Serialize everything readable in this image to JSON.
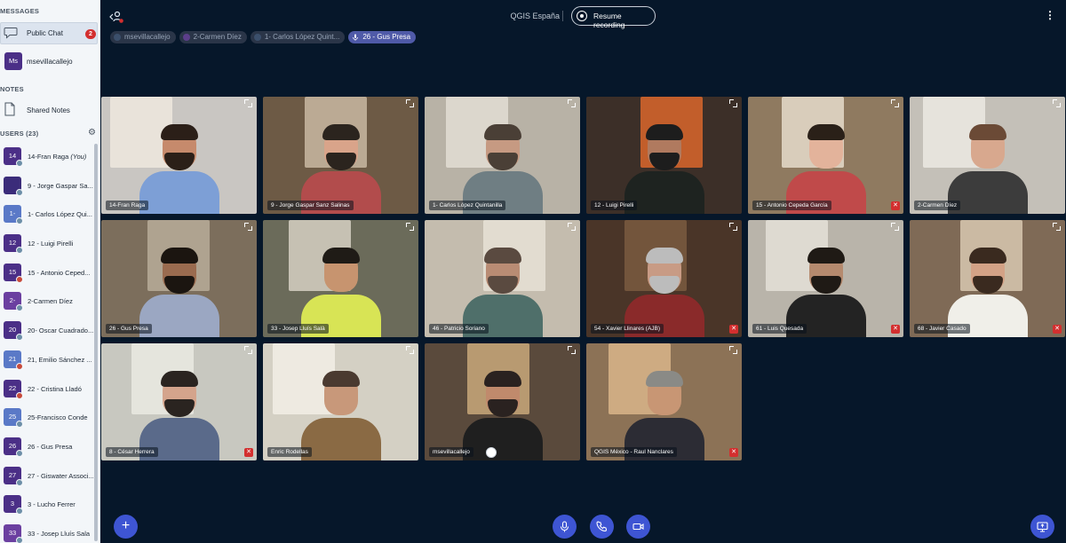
{
  "sidebar": {
    "messages_title": "MESSAGES",
    "public_chat": {
      "label": "Public Chat",
      "unread": "2"
    },
    "direct_chat": {
      "initials": "Ms",
      "label": "msevillacallejo"
    },
    "notes_title": "NOTES",
    "shared_notes": "Shared Notes",
    "users_title": "USERS (23)",
    "users": [
      {
        "initials": "14",
        "name": "14-Fran Raga",
        "suffix": " (You)",
        "color": "#4b2f87",
        "status": "#6d8fa8"
      },
      {
        "initials": "",
        "name": "9 - Jorge Gaspar Sa...",
        "suffix": "",
        "color": "#3b2c7a",
        "status": "#6d8fa8"
      },
      {
        "initials": "1-",
        "name": "1- Carlos López Qui...",
        "suffix": "",
        "color": "#5a79c7",
        "status": "#6d8fa8"
      },
      {
        "initials": "12",
        "name": "12 - Luigi Pirelli",
        "suffix": "",
        "color": "#4b2f87",
        "status": "#6d8fa8"
      },
      {
        "initials": "15",
        "name": "15 - Antonio Ceped...",
        "suffix": "",
        "color": "#4b2f87",
        "status": "#c84a3a"
      },
      {
        "initials": "2-",
        "name": "2-Carmen Díez",
        "suffix": "",
        "color": "#6b3fa0",
        "status": "#6d8fa8"
      },
      {
        "initials": "20",
        "name": "20- Oscar Cuadrado...",
        "suffix": "",
        "color": "#4b2f87",
        "status": "#6d8fa8"
      },
      {
        "initials": "21",
        "name": "21, Emilio Sánchez ...",
        "suffix": "",
        "color": "#5a79c7",
        "status": "#c84a3a"
      },
      {
        "initials": "22",
        "name": "22 - Cristina Lladó",
        "suffix": "",
        "color": "#4b2f87",
        "status": "#c84a3a"
      },
      {
        "initials": "25",
        "name": "25-Francisco Conde",
        "suffix": "",
        "color": "#5a79c7",
        "status": "#6d8fa8"
      },
      {
        "initials": "26",
        "name": "26 - Gus Presa",
        "suffix": "",
        "color": "#4b2f87",
        "status": "#6d8fa8"
      },
      {
        "initials": "27",
        "name": "27 - Giswater Associ...",
        "suffix": "",
        "color": "#4b2f87",
        "status": "#6d8fa8"
      },
      {
        "initials": "3",
        "name": "3 - Lucho Ferrer",
        "suffix": "",
        "color": "#4b2f87",
        "status": "#6d8fa8"
      },
      {
        "initials": "33",
        "name": "33 - Josep Lluís Sala",
        "suffix": "",
        "color": "#6b3fa0",
        "status": "#6d8fa8"
      }
    ]
  },
  "topbar": {
    "meeting_title": "QGIS España",
    "record_label": "Resume recording",
    "more_icon": "more-vertical-icon"
  },
  "talkers": [
    {
      "label": "msevillacallejo",
      "dot": "#3b4f6b",
      "active": false
    },
    {
      "label": "2-Carmen Díez",
      "dot": "#5b3e8a",
      "active": false
    },
    {
      "label": "1- Carlos López Quint...",
      "dot": "#3b4f6b",
      "active": false
    },
    {
      "label": "26 - Gus Presa",
      "dot": "mic",
      "active": true
    }
  ],
  "videos": [
    {
      "name": "14-Fran Raga",
      "muted": false,
      "bg": "#c9c6c2",
      "wall": "#efe8de",
      "shirt": "#7d9fd6",
      "skin": "#c68a6c",
      "hair": "#2b1f18",
      "beard": true
    },
    {
      "name": "9 - Jorge Gaspar Sanz Salinas",
      "muted": false,
      "bg": "#6d5a45",
      "wall": "#c9b8a2",
      "shirt": "#b24c4c",
      "skin": "#d9a48a",
      "hair": "#2b241e",
      "beard": true
    },
    {
      "name": "1- Carlos López Quintanilla",
      "muted": false,
      "bg": "#b8b2a6",
      "wall": "#e2ddd3",
      "shirt": "#6f7e83",
      "skin": "#c69a82",
      "hair": "#4a3f36",
      "beard": true
    },
    {
      "name": "12 - Luigi Pirelli",
      "muted": false,
      "bg": "#3c2f28",
      "wall": "#d9662b",
      "shirt": "#1e2320",
      "skin": "#b07a5f",
      "hair": "#1d1d1d",
      "beard": true
    },
    {
      "name": "15 - Antonio Cepeda García",
      "muted": true,
      "bg": "#8f7a60",
      "wall": "#e6dccb",
      "shirt": "#c04a4a",
      "skin": "#e3b39b",
      "hair": "#2a2018",
      "beard": false
    },
    {
      "name": "2-Carmen Díez",
      "muted": false,
      "bg": "#c4c0b8",
      "wall": "#ece9e2",
      "shirt": "#3c3c3c",
      "skin": "#d8a88e",
      "hair": "#6b4a36",
      "beard": false
    },
    {
      "name": "26 - Gus Presa",
      "muted": false,
      "bg": "#7c6e5c",
      "wall": "#b9ad99",
      "shirt": "#9ba7c2",
      "skin": "#9a6b4f",
      "hair": "#1b1510",
      "beard": true
    },
    {
      "name": "33 - Josep Lluís Salà",
      "muted": false,
      "bg": "#6b6b5a",
      "wall": "#d6d0c3",
      "shirt": "#d8e455",
      "skin": "#c7946f",
      "hair": "#1f1b16",
      "beard": false
    },
    {
      "name": "46 - Patricio Soriano",
      "muted": false,
      "bg": "#c4bcae",
      "wall": "#e8e2d6",
      "shirt": "#4f6f6a",
      "skin": "#b98c74",
      "hair": "#5a4a40",
      "beard": true
    },
    {
      "name": "54 - Xavier Llinares (AJB)",
      "muted": true,
      "bg": "#4a3528",
      "wall": "#7a5a40",
      "shirt": "#8a2a2a",
      "skin": "#c89b85",
      "hair": "#bcbcbc",
      "beard": true
    },
    {
      "name": "61 - Luis Quesada",
      "muted": true,
      "bg": "#b9b4aa",
      "wall": "#e4e0d8",
      "shirt": "#232323",
      "skin": "#b58a6e",
      "hair": "#1f1a15",
      "beard": true
    },
    {
      "name": "68 - Javier Casado",
      "muted": true,
      "bg": "#7f6a56",
      "wall": "#d8c8b0",
      "shirt": "#f0efe9",
      "skin": "#d3a286",
      "hair": "#3a2a1f",
      "beard": true
    },
    {
      "name": "8 - César Herrera",
      "muted": true,
      "bg": "#c8c8c0",
      "wall": "#eaeae2",
      "shirt": "#5a6a8a",
      "skin": "#d4a48c",
      "hair": "#2a2420",
      "beard": true
    },
    {
      "name": "Enric Rodellas",
      "muted": false,
      "bg": "#d4d0c4",
      "wall": "#f2efe6",
      "shirt": "#8a6a44",
      "skin": "#c8987a",
      "hair": "#4a3a30",
      "beard": false
    },
    {
      "name": "msevillacallejo",
      "muted": false,
      "own": true,
      "bg": "#5a4a3c",
      "wall": "#c9a87a",
      "shirt": "#1f1f1f",
      "skin": "#c08a6c",
      "hair": "#2a2220",
      "beard": true
    },
    {
      "name": "QGIS México - Raul Nanclares",
      "muted": true,
      "bg": "#8c7256",
      "wall": "#d9b58a",
      "shirt": "#2c2c34",
      "skin": "#c89674",
      "hair": "#8a8a86",
      "beard": false
    }
  ],
  "controls": {
    "add_icon": "plus-icon",
    "mic_icon": "microphone-icon",
    "phone_icon": "phone-icon",
    "cam_icon": "video-camera-icon",
    "share_icon": "screen-share-icon"
  }
}
